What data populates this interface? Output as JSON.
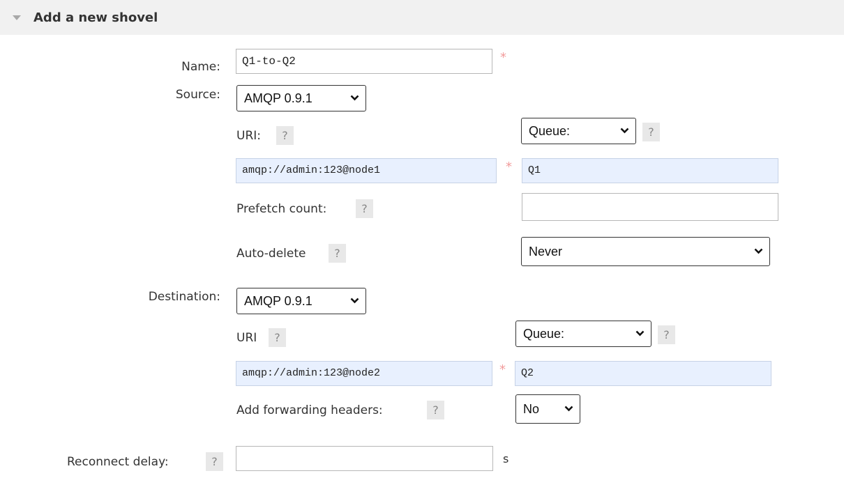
{
  "header": {
    "title": "Add a new shovel"
  },
  "form": {
    "name": {
      "label": "Name:",
      "value": "Q1-to-Q2"
    },
    "source": {
      "label": "Source:",
      "protocol": "AMQP 0.9.1",
      "uri_label": "URI:",
      "uri_value": "amqp://admin:123@node1",
      "type": "Queue:",
      "type_value": "Q1",
      "prefetch_label": "Prefetch count:",
      "prefetch_value": "",
      "autodelete_label": "Auto-delete",
      "autodelete_value": "Never"
    },
    "destination": {
      "label": "Destination:",
      "protocol": "AMQP 0.9.1",
      "uri_label": "URI",
      "uri_value": "amqp://admin:123@node2",
      "type": "Queue:",
      "type_value": "Q2",
      "fwd_label": "Add forwarding headers:",
      "fwd_value": "No"
    },
    "reconnect": {
      "label": "Reconnect delay:",
      "value": "",
      "unit": "s"
    }
  },
  "help_glyph": "?",
  "required_glyph": "*",
  "icons": {
    "collapse": "triangle-down-icon",
    "dropdown": "chevron-down-icon"
  }
}
